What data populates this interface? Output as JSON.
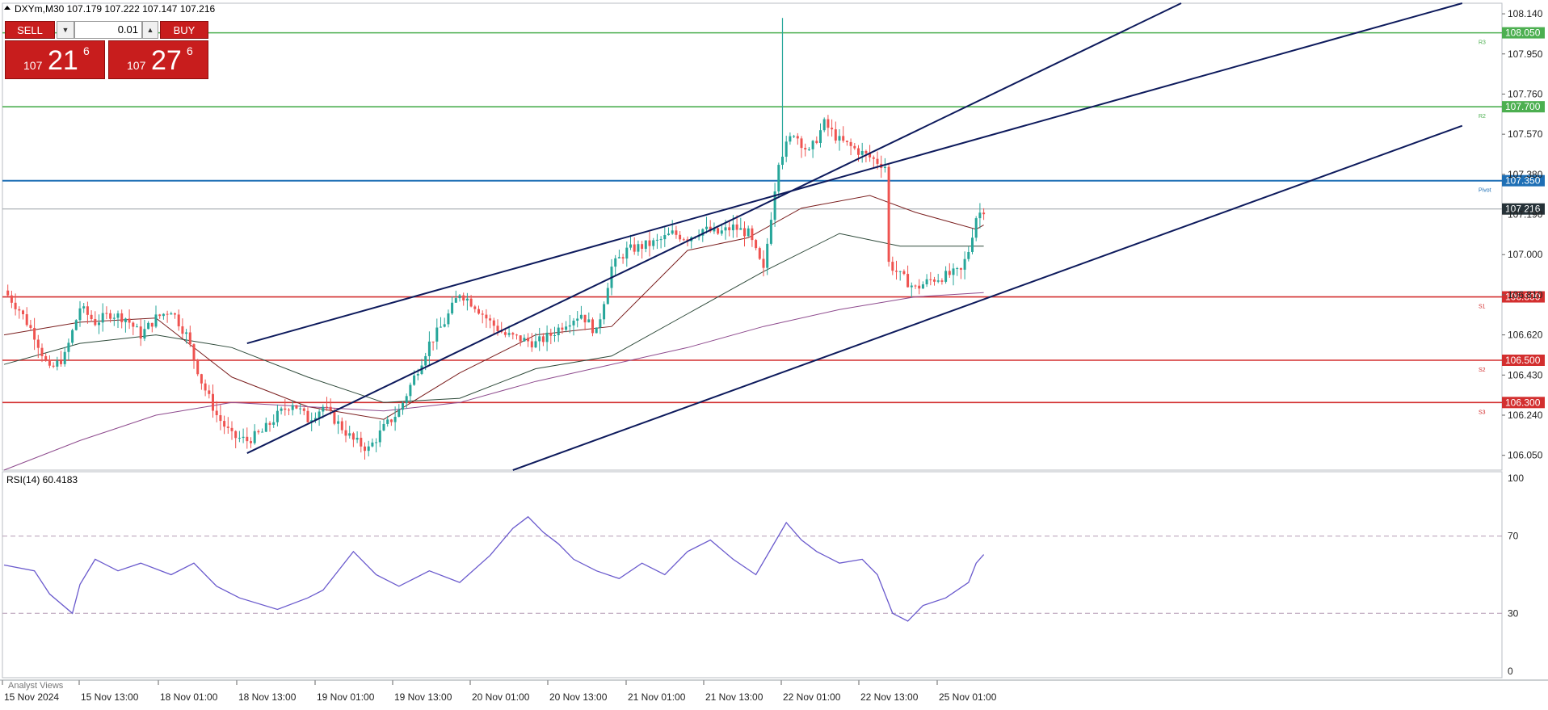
{
  "symbol_header": "DXYm,M30  107.179 107.222 107.147 107.216",
  "trade_panel": {
    "sell_label": "SELL",
    "buy_label": "BUY",
    "lot_value": "0.01",
    "sell_quote": {
      "prefix": "107",
      "big": "21",
      "sup": "6"
    },
    "buy_quote": {
      "prefix": "107",
      "big": "27",
      "sup": "6"
    }
  },
  "indicator_label": "RSI(14) 60.4183",
  "bottom_tab_label": "Analyst Views",
  "colors": {
    "bull_candle": "#26a69a",
    "bear_candle": "#ef5350",
    "resistance": "#4caf50",
    "pivot": "#1e6fb5",
    "support": "#d32f2f",
    "channel": "#0d1a5c",
    "rsi_line": "#6a5acd",
    "current_price_bg": "#263238"
  },
  "chart_data": {
    "type": "candlestick",
    "symbol": "DXYm",
    "timeframe": "M30",
    "last_ohlc": {
      "open": 107.179,
      "high": 107.222,
      "low": 107.147,
      "close": 107.216
    },
    "y_axis": {
      "range": [
        105.98,
        108.19
      ],
      "ticks": [
        "108.140",
        "107.950",
        "107.760",
        "107.570",
        "107.380",
        "107.190",
        "107.000",
        "106.810",
        "106.620",
        "106.430",
        "106.240",
        "106.050"
      ]
    },
    "x_axis": {
      "labels": [
        "15 Nov 2024",
        "15 Nov 13:00",
        "18 Nov 01:00",
        "18 Nov 13:00",
        "19 Nov 01:00",
        "19 Nov 13:00",
        "20 Nov 01:00",
        "20 Nov 13:00",
        "21 Nov 01:00",
        "21 Nov 13:00",
        "22 Nov 01:00",
        "22 Nov 13:00",
        "25 Nov 01:00"
      ]
    },
    "current_price": "107.216",
    "levels": [
      {
        "name": "R3",
        "price": "108.050",
        "kind": "resistance"
      },
      {
        "name": "R2",
        "price": "107.700",
        "kind": "resistance"
      },
      {
        "name": "Pivot",
        "price": "107.350",
        "kind": "pivot"
      },
      {
        "name": "S1",
        "price": "106.800",
        "kind": "support"
      },
      {
        "name": "S2",
        "price": "106.500",
        "kind": "support"
      },
      {
        "name": "S3",
        "price": "106.300",
        "kind": "support"
      }
    ],
    "close_path": [
      [
        0,
        106.83
      ],
      [
        4,
        106.74
      ],
      [
        8,
        106.62
      ],
      [
        12,
        106.45
      ],
      [
        16,
        106.52
      ],
      [
        20,
        106.75
      ],
      [
        24,
        106.68
      ],
      [
        28,
        106.72
      ],
      [
        32,
        106.7
      ],
      [
        36,
        106.62
      ],
      [
        40,
        106.7
      ],
      [
        44,
        106.74
      ],
      [
        48,
        106.62
      ],
      [
        52,
        106.4
      ],
      [
        56,
        106.24
      ],
      [
        60,
        106.14
      ],
      [
        64,
        106.12
      ],
      [
        68,
        106.16
      ],
      [
        72,
        106.24
      ],
      [
        76,
        106.3
      ],
      [
        80,
        106.22
      ],
      [
        84,
        106.28
      ],
      [
        88,
        106.2
      ],
      [
        92,
        106.12
      ],
      [
        96,
        106.08
      ],
      [
        100,
        106.18
      ],
      [
        104,
        106.26
      ],
      [
        108,
        106.42
      ],
      [
        112,
        106.58
      ],
      [
        116,
        106.68
      ],
      [
        120,
        106.82
      ],
      [
        124,
        106.76
      ],
      [
        128,
        106.68
      ],
      [
        132,
        106.62
      ],
      [
        136,
        106.6
      ],
      [
        140,
        106.58
      ],
      [
        144,
        106.62
      ],
      [
        148,
        106.68
      ],
      [
        152,
        106.72
      ],
      [
        156,
        106.63
      ],
      [
        160,
        106.94
      ],
      [
        164,
        107.02
      ],
      [
        168,
        107.04
      ],
      [
        172,
        107.06
      ],
      [
        176,
        107.1
      ],
      [
        180,
        107.08
      ],
      [
        184,
        107.12
      ],
      [
        188,
        107.1
      ],
      [
        192,
        107.13
      ],
      [
        196,
        107.1
      ],
      [
        200,
        106.92
      ],
      [
        204,
        107.45
      ],
      [
        208,
        107.58
      ],
      [
        212,
        107.48
      ],
      [
        216,
        107.62
      ],
      [
        220,
        107.54
      ],
      [
        224,
        107.5
      ],
      [
        228,
        107.46
      ],
      [
        232,
        107.42
      ],
      [
        233,
        106.96
      ],
      [
        236,
        106.9
      ],
      [
        240,
        106.84
      ],
      [
        244,
        106.88
      ],
      [
        248,
        106.9
      ],
      [
        252,
        106.92
      ],
      [
        254,
        107.02
      ],
      [
        256,
        107.18
      ],
      [
        258,
        107.216
      ]
    ],
    "moving_averages": [
      {
        "points": [
          [
            0,
            106.62
          ],
          [
            20,
            106.68
          ],
          [
            40,
            106.7
          ],
          [
            60,
            106.42
          ],
          [
            80,
            106.28
          ],
          [
            100,
            106.22
          ],
          [
            120,
            106.44
          ],
          [
            140,
            106.62
          ],
          [
            160,
            106.66
          ],
          [
            180,
            107.02
          ],
          [
            196,
            107.08
          ],
          [
            210,
            107.22
          ],
          [
            228,
            107.28
          ],
          [
            240,
            107.2
          ],
          [
            256,
            107.12
          ],
          [
            258,
            107.14
          ]
        ]
      },
      {
        "points": [
          [
            0,
            106.48
          ],
          [
            20,
            106.58
          ],
          [
            40,
            106.62
          ],
          [
            60,
            106.56
          ],
          [
            80,
            106.42
          ],
          [
            100,
            106.3
          ],
          [
            120,
            106.32
          ],
          [
            140,
            106.46
          ],
          [
            160,
            106.52
          ],
          [
            180,
            106.72
          ],
          [
            200,
            106.92
          ],
          [
            220,
            107.1
          ],
          [
            236,
            107.04
          ],
          [
            258,
            107.04
          ]
        ]
      },
      {
        "points": [
          [
            0,
            105.98
          ],
          [
            20,
            106.12
          ],
          [
            40,
            106.24
          ],
          [
            60,
            106.3
          ],
          [
            80,
            106.28
          ],
          [
            100,
            106.26
          ],
          [
            120,
            106.3
          ],
          [
            140,
            106.4
          ],
          [
            160,
            106.48
          ],
          [
            180,
            106.56
          ],
          [
            200,
            106.66
          ],
          [
            220,
            106.74
          ],
          [
            240,
            106.8
          ],
          [
            258,
            106.82
          ]
        ]
      }
    ],
    "channel_lines": [
      {
        "from": [
          64,
          106.06
        ],
        "to": [
          310,
          108.19
        ]
      },
      {
        "from": [
          64,
          106.58
        ],
        "to": [
          384,
          108.19
        ]
      },
      {
        "from": [
          134,
          105.98
        ],
        "to": [
          384,
          107.61
        ]
      }
    ],
    "rsi": {
      "label": "RSI(14)",
      "value": "60.4183",
      "y_range": [
        0,
        100
      ],
      "ticks": [
        "100",
        "70",
        "30",
        "0"
      ],
      "levels": [
        70,
        30
      ],
      "values": [
        [
          0,
          55
        ],
        [
          8,
          52
        ],
        [
          12,
          40
        ],
        [
          18,
          30
        ],
        [
          20,
          45
        ],
        [
          24,
          58
        ],
        [
          30,
          52
        ],
        [
          36,
          56
        ],
        [
          44,
          50
        ],
        [
          50,
          56
        ],
        [
          56,
          44
        ],
        [
          62,
          38
        ],
        [
          72,
          32
        ],
        [
          80,
          38
        ],
        [
          84,
          42
        ],
        [
          92,
          62
        ],
        [
          98,
          50
        ],
        [
          104,
          44
        ],
        [
          112,
          52
        ],
        [
          120,
          46
        ],
        [
          128,
          60
        ],
        [
          134,
          74
        ],
        [
          138,
          80
        ],
        [
          142,
          72
        ],
        [
          146,
          66
        ],
        [
          150,
          58
        ],
        [
          156,
          52
        ],
        [
          162,
          48
        ],
        [
          168,
          56
        ],
        [
          174,
          50
        ],
        [
          180,
          62
        ],
        [
          186,
          68
        ],
        [
          192,
          58
        ],
        [
          198,
          50
        ],
        [
          206,
          77
        ],
        [
          210,
          68
        ],
        [
          214,
          62
        ],
        [
          220,
          56
        ],
        [
          226,
          58
        ],
        [
          230,
          50
        ],
        [
          234,
          30
        ],
        [
          238,
          26
        ],
        [
          242,
          34
        ],
        [
          248,
          38
        ],
        [
          254,
          46
        ],
        [
          256,
          56
        ],
        [
          258,
          60.4
        ]
      ]
    }
  }
}
